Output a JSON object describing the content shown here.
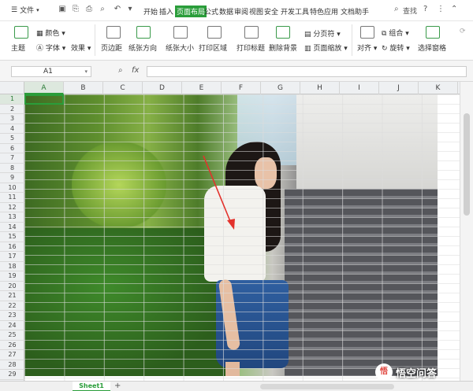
{
  "menubar": {
    "file_label": "文件",
    "tabs": [
      {
        "label": "开始",
        "active": false
      },
      {
        "label": "插入",
        "active": false
      },
      {
        "label": "页面布局",
        "active": true
      },
      {
        "label": "公式",
        "active": false
      },
      {
        "label": "数据",
        "active": false
      },
      {
        "label": "审阅",
        "active": false
      },
      {
        "label": "视图",
        "active": false
      },
      {
        "label": "安全",
        "active": false
      },
      {
        "label": "开发工具",
        "active": false
      },
      {
        "label": "特色应用",
        "active": false
      },
      {
        "label": "文档助手",
        "active": false
      }
    ],
    "search_label": "查找",
    "help_symbol": "?",
    "accent": "#2a9d3a"
  },
  "ribbon": {
    "theme": "主题",
    "colors": "颜色",
    "fonts": "字体",
    "effects": "效果",
    "margins": "页边距",
    "orientation": "纸张方向",
    "size": "纸张大小",
    "print_area": "打印区域",
    "print_titles": "打印标题",
    "delete_background": "删除背景",
    "page_break": "分页符",
    "page_zoom": "页面缩放",
    "align": "对齐",
    "group": "组合",
    "rotate": "旋转",
    "selection_pane": "选择窗格"
  },
  "formula_bar": {
    "name_box": "A1",
    "fx_label": "fx"
  },
  "grid": {
    "columns": [
      "A",
      "B",
      "C",
      "D",
      "E",
      "F",
      "G",
      "H",
      "I",
      "J",
      "K"
    ],
    "rows": [
      "1",
      "2",
      "3",
      "4",
      "5",
      "6",
      "7",
      "8",
      "9",
      "10",
      "11",
      "12",
      "13",
      "14",
      "15",
      "16",
      "17",
      "18",
      "19",
      "20",
      "21",
      "22",
      "23",
      "24",
      "25",
      "26",
      "27",
      "28",
      "29"
    ],
    "selected_cell": "A1"
  },
  "bottom": {
    "sheet_tab": "Sheet1",
    "add_sheet": "+"
  },
  "watermark": {
    "text": "悟空问答",
    "logo_text": "悟"
  }
}
